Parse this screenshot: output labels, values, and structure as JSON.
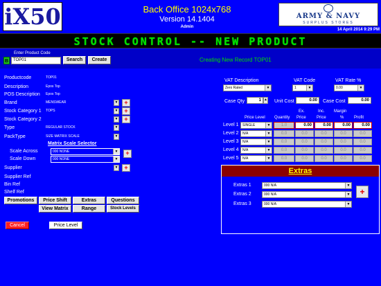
{
  "header": {
    "logo_text": "iX50",
    "title": "Back Office 1024x768",
    "version": "Version 14.1404",
    "user": "Admin",
    "brand_line1": "ARMY & NAVY",
    "brand_line2": "SURPLUS STORES",
    "datetime": "14 April 2014 9:29 PM",
    "banner": "STOCK CONTROL -- NEW PRODUCT"
  },
  "product_code_bar": {
    "label": "Enter Product Code",
    "b_label": "B",
    "value": "TOP01",
    "search_label": "Search",
    "create_label": "Create",
    "status": "Creating New Record TOP01"
  },
  "fields": {
    "productcode_label": "Productcode",
    "productcode_value": "TOP01",
    "description_label": "Description",
    "description_value": "Epos Top",
    "pos_label": "POS Description",
    "pos_value": "Epos Top",
    "brand_label": "Brand",
    "brand_value": "MENSWEAR",
    "cat1_label": "Stock Category 1",
    "cat1_value": "TOPS",
    "cat2_label": "Stock Category 2",
    "cat2_value": "",
    "type_label": "Type",
    "type_value": "REGULAR STOCK",
    "packtype_label": "PackType",
    "packtype_value": "SIZE MATRIX SCALE",
    "matrix_title": "Matrix Scale Selector",
    "scale_across_label": "Scale Across",
    "scale_across_value": "000 NONE",
    "scale_down_label": "Scale Down",
    "scale_down_value": "000 NONE",
    "supplier_label": "Supplier",
    "supplier_value": "",
    "supplier_ref_label": "Supplier Ref",
    "bin_ref_label": "Bin Ref",
    "shelf_ref_label": "Shelf Ref"
  },
  "buttons": {
    "promotions": "Promotions",
    "price_shift": "Price Shift",
    "extras": "Extras",
    "questions": "Questions",
    "view_matrix": "View Matrix",
    "range": "Range",
    "stock_levels": "Stock Levels",
    "cancel": "Cancel",
    "price_level": "Price Level"
  },
  "vat": {
    "desc_label": "VAT Description",
    "desc_value": "Zero Rated",
    "code_label": "VAT Code",
    "code_value": "1",
    "rate_label": "VAT Rate %",
    "rate_value": "0.00"
  },
  "cost": {
    "case_qty_label": "Case Qty",
    "case_qty_value": "1",
    "unit_cost_label": "Unit Cost",
    "unit_cost_value": "0.00",
    "case_cost_label": "Case Cost",
    "case_cost_value": "0.00"
  },
  "pricing": {
    "headers": {
      "price_level": "Price Level",
      "quantity": "Quantity",
      "ex_price_1": "Ex.",
      "ex_price_2": "Price",
      "inc_price_1": "Inc.",
      "inc_price_2": "Price",
      "margin_1": "Margin",
      "margin_2": "%",
      "profit": "Profit"
    },
    "rows": [
      {
        "label": "Level 1",
        "level": "SINGLE",
        "qty": "1.0",
        "ex": "0.00",
        "inc": "0.00",
        "margin": "0.00",
        "profit": "0.00"
      },
      {
        "label": "Level 2",
        "level": "N/A",
        "qty": "0.0",
        "ex": "0.0",
        "inc": "0.0",
        "margin": "0.0",
        "profit": "0.0"
      },
      {
        "label": "Level 3",
        "level": "N/A",
        "qty": "0.0",
        "ex": "0.0",
        "inc": "0.0",
        "margin": "0.0",
        "profit": "0.0"
      },
      {
        "label": "Level 4",
        "level": "N/A",
        "qty": "0.0",
        "ex": "0.0",
        "inc": "0.0",
        "margin": "0.0",
        "profit": "0.0"
      },
      {
        "label": "Level 5",
        "level": "N/A",
        "qty": "0.0",
        "ex": "0.0",
        "inc": "0.0",
        "margin": "0.0",
        "profit": "0.0"
      }
    ]
  },
  "extras_panel": {
    "title": "Extras",
    "rows": [
      {
        "label": "Extras 1",
        "value": "000 N/A"
      },
      {
        "label": "Extras 2",
        "value": "000 N/A"
      },
      {
        "label": "Extras 3",
        "value": "000 N/A"
      }
    ]
  },
  "icons": {
    "dropdown": "chevron-down-icon",
    "add": "plus-icon"
  },
  "colors": {
    "background": "#0000fe",
    "banner_text": "#00e000",
    "accent_red": "#e00000",
    "panel_header": "#8b0000",
    "title_yellow": "#ffff00"
  }
}
